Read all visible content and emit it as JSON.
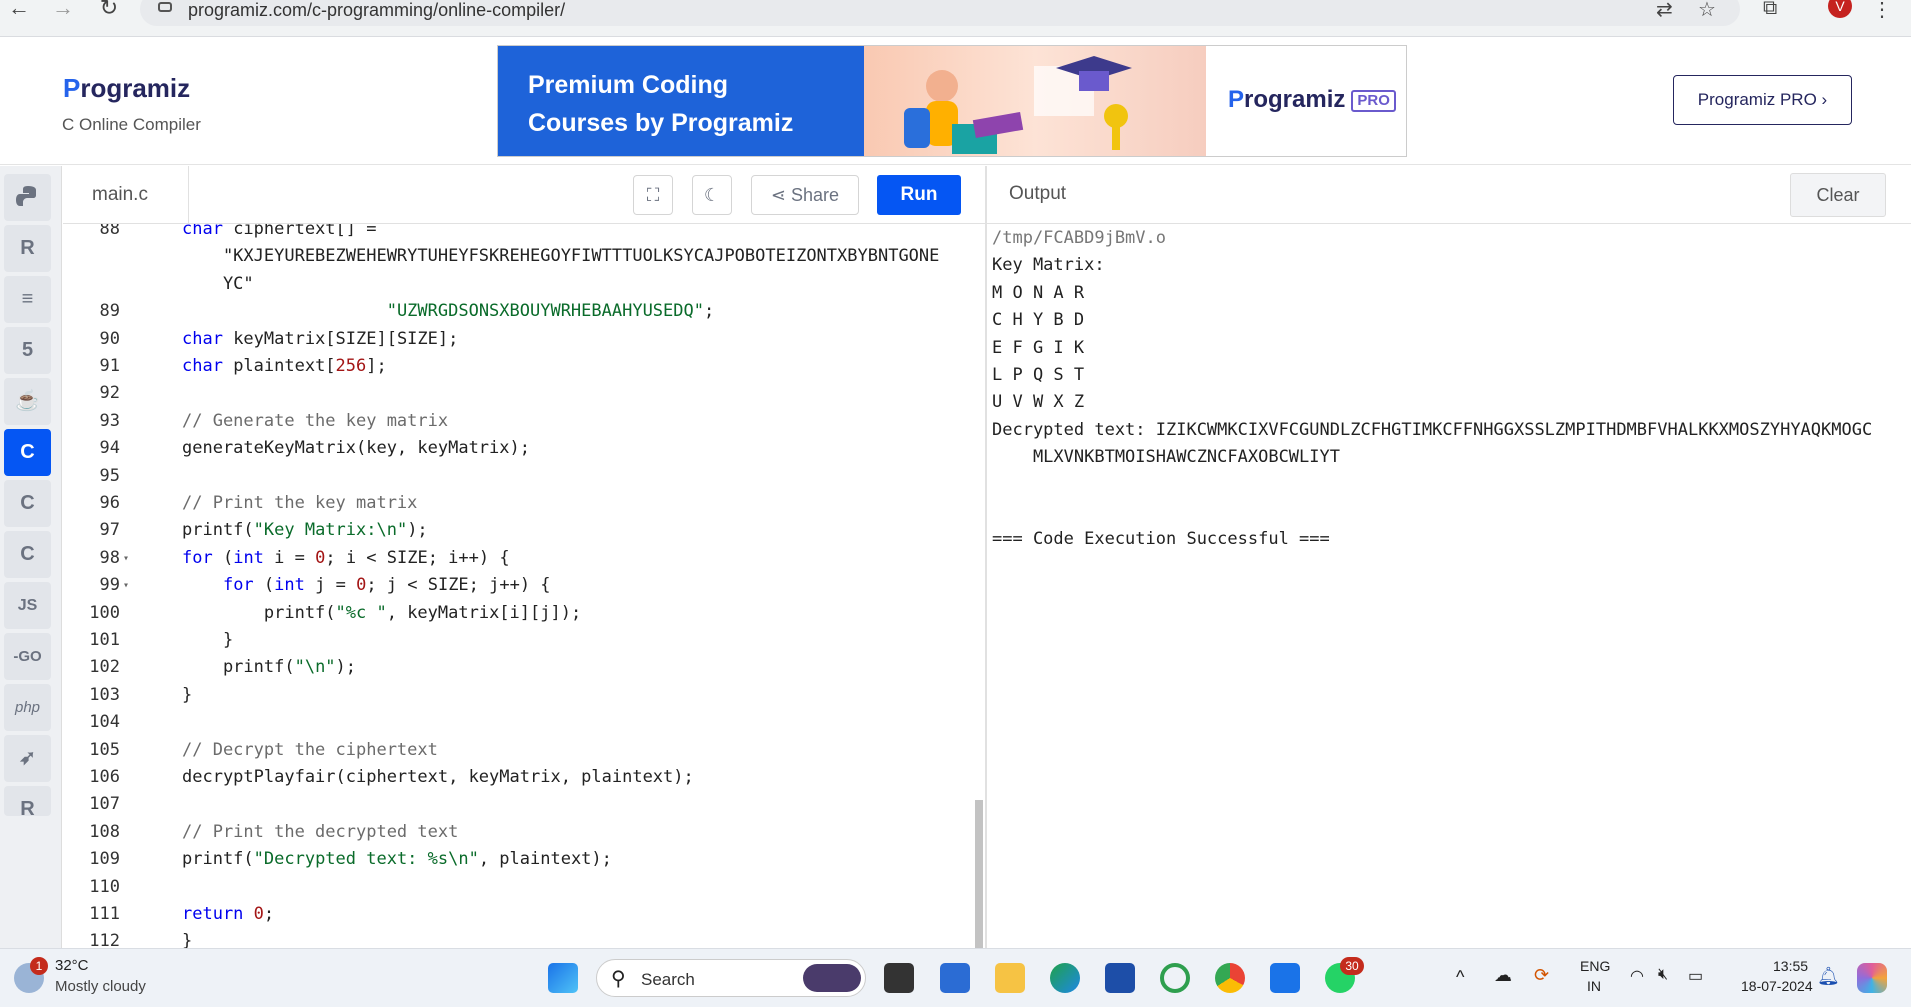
{
  "browser": {
    "url": "programiz.com/c-programming/online-compiler/",
    "avatar": "V"
  },
  "header": {
    "logo": "rogramiz",
    "logo_p": "P",
    "subtitle": "C Online Compiler",
    "banner_text_1": "Premium Coding",
    "banner_text_2": "Courses by Programiz",
    "banner_logo": "rogramiz",
    "banner_logo_p": "P",
    "banner_pro": "PRO",
    "pro_button": "Programiz PRO ›"
  },
  "sidebar": {
    "items": [
      "py",
      "R",
      "db",
      "5",
      "☕",
      "C",
      "C",
      "C",
      "JS",
      "GO",
      "php",
      "sw",
      "R"
    ]
  },
  "editor": {
    "file_tab": "main.c",
    "share": "Share",
    "run": "Run"
  },
  "code": [
    {
      "n": "88",
      "t": "char ciphertext[] ="
    },
    {
      "n": "",
      "t": "    \"KXJEYUREBEZWEHEWRYTUHEYFSKREHEGOYFIWTTTUOLKSYCAJPOBOTEIZONTXBYBNTGONE"
    },
    {
      "n": "",
      "t": "    YC\""
    },
    {
      "n": "89",
      "t": "                    \"UZWRGDSONSXBOUYWRHEBAAHYUSEDQ\";"
    },
    {
      "n": "90",
      "t": "char keyMatrix[SIZE][SIZE];"
    },
    {
      "n": "91",
      "t": "char plaintext[256];"
    },
    {
      "n": "92",
      "t": ""
    },
    {
      "n": "93",
      "t": "// Generate the key matrix"
    },
    {
      "n": "94",
      "t": "generateKeyMatrix(key, keyMatrix);"
    },
    {
      "n": "95",
      "t": ""
    },
    {
      "n": "96",
      "t": "// Print the key matrix"
    },
    {
      "n": "97",
      "t": "printf(\"Key Matrix:\\n\");"
    },
    {
      "n": "98",
      "t": "for (int i = 0; i < SIZE; i++) {"
    },
    {
      "n": "99",
      "t": "    for (int j = 0; j < SIZE; j++) {"
    },
    {
      "n": "100",
      "t": "        printf(\"%c \", keyMatrix[i][j]);"
    },
    {
      "n": "101",
      "t": "    }"
    },
    {
      "n": "102",
      "t": "    printf(\"\\n\");"
    },
    {
      "n": "103",
      "t": "}"
    },
    {
      "n": "104",
      "t": ""
    },
    {
      "n": "105",
      "t": "// Decrypt the ciphertext"
    },
    {
      "n": "106",
      "t": "decryptPlayfair(ciphertext, keyMatrix, plaintext);"
    },
    {
      "n": "107",
      "t": ""
    },
    {
      "n": "108",
      "t": "// Print the decrypted text"
    },
    {
      "n": "109",
      "t": "printf(\"Decrypted text: %s\\n\", plaintext);"
    },
    {
      "n": "110",
      "t": ""
    },
    {
      "n": "111",
      "t": "return 0;"
    },
    {
      "n": "112",
      "t": "}"
    }
  ],
  "output": {
    "title": "Output",
    "clear": "Clear",
    "lines": [
      "/tmp/FCABD9jBmV.o",
      "Key Matrix:",
      "M O N A R",
      "C H Y B D",
      "E F G I K",
      "L P Q S T",
      "U V W X Z",
      "Decrypted text: IZIKCWMKCIXVFCGUNDLZCFHGTIMKCFFNHGGXSSLZMPITHDMBFVHALKKXMOSZYHYAQKMOGC",
      "    MLXVNKBTMOISHAWCZNCFAXOBCWLIYT",
      "",
      "",
      "=== Code Execution Successful ==="
    ]
  },
  "taskbar": {
    "temp": "32°C",
    "weather": "Mostly cloudy",
    "weather_badge": "1",
    "search": "Search",
    "lang1": "ENG",
    "lang2": "IN",
    "time": "13:55",
    "date": "18-07-2024",
    "wa_badge": "30"
  }
}
